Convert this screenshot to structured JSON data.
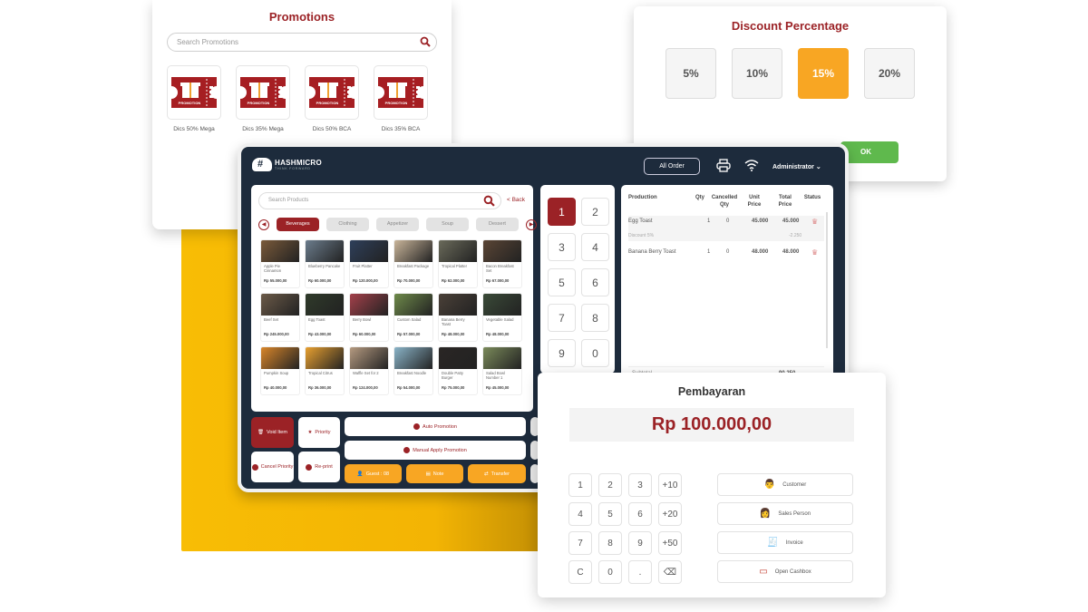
{
  "promotions": {
    "title": "Promotions",
    "search_placeholder": "Search Promotions",
    "ticket_text": "PROMOTION",
    "items": [
      {
        "label": "Dics 50% Mega"
      },
      {
        "label": "Dics 35% Mega"
      },
      {
        "label": "Dics 50% BCA"
      },
      {
        "label": "Dics 35% BCA"
      }
    ]
  },
  "discount": {
    "title": "Discount Percentage",
    "options": [
      "5%",
      "10%",
      "15%",
      "20%"
    ],
    "selected": "15%",
    "ok_label": "OK"
  },
  "header": {
    "brand": "HASHMICRO",
    "tagline": "THINK FORWARD",
    "all_order_label": "All Order",
    "user": "Administrator"
  },
  "products": {
    "search_placeholder": "Search Products",
    "back_label": "< Back",
    "categories": [
      "Beverages",
      "Clothing",
      "Appetizer",
      "Soup",
      "Dessert"
    ],
    "selected_category": "Beverages",
    "items": [
      {
        "name": "Apple Pie Cinnamon",
        "price": "Rp 55.000,00",
        "color": "#7a5a3a"
      },
      {
        "name": "Blueberry Pancake",
        "price": "Rp 60.000,00",
        "color": "#6b7c8c"
      },
      {
        "name": "Fruit Platter",
        "price": "Rp 120.000,00",
        "color": "#2e3f5a"
      },
      {
        "name": "Breakfast Package",
        "price": "Rp 70.000,00",
        "color": "#c9b59a"
      },
      {
        "name": "Tropical Platter",
        "price": "Rp 62.000,00",
        "color": "#6a6a5a"
      },
      {
        "name": "Bacon Breakfast Set",
        "price": "Rp 67.000,00",
        "color": "#5a4535"
      },
      {
        "name": "Beef Set",
        "price": "Rp 245.000,00",
        "color": "#6b5a48"
      },
      {
        "name": "Egg Toast",
        "price": "Rp 43.000,00",
        "color": "#2f3a2a"
      },
      {
        "name": "Berry Bowl",
        "price": "Rp 60.000,00",
        "color": "#a3404a"
      },
      {
        "name": "Custom Salad",
        "price": "Rp 57.000,00",
        "color": "#6e8a4a"
      },
      {
        "name": "Banana Berry Toast",
        "price": "Rp 48.000,00",
        "color": "#4a4038"
      },
      {
        "name": "Vegetable Salad",
        "price": "Rp 48.000,00",
        "color": "#3a4a38"
      },
      {
        "name": "Pumpkin Soup",
        "price": "Rp 40.000,00",
        "color": "#d9862a"
      },
      {
        "name": "Tropical Citrus",
        "price": "Rp 36.000,00",
        "color": "#e8a030"
      },
      {
        "name": "Waffle Set for 2",
        "price": "Rp 124.000,00",
        "color": "#b59a80"
      },
      {
        "name": "Breakfast Noodle",
        "price": "Rp 54.000,00",
        "color": "#8ab4c8"
      },
      {
        "name": "Double Patty Burger",
        "price": "Rp 75.000,00",
        "color": "#2a2624"
      },
      {
        "name": "Salad Bowl Number 1",
        "price": "Rp 45.000,00",
        "color": "#7a8a5a"
      }
    ]
  },
  "numpad": [
    "1",
    "2",
    "3",
    "4",
    "5",
    "6",
    "7",
    "8",
    "9",
    "0"
  ],
  "numpad_selected": "1",
  "order": {
    "headers": [
      "Production",
      "Qty",
      "Cancelled Qty",
      "Unit Price",
      "Total Price",
      "Status"
    ],
    "rows": [
      {
        "name": "Egg Toast",
        "qty": "1",
        "cancelled": "0",
        "unit": "45.000",
        "total": "45.000",
        "discount_label": "Discount 5%",
        "discount_value": "-2.250"
      },
      {
        "name": "Banana Berry Toast",
        "qty": "1",
        "cancelled": "0",
        "unit": "48.000",
        "total": "48.000"
      }
    ],
    "subtotal_label": "Subtotal",
    "subtotal_value": "90.250"
  },
  "actions": {
    "void_item": "Void Item",
    "priority": "Priority",
    "cancel_priority": "Cancel Priority",
    "reprint": "Re-print",
    "auto_promotion": "Auto Promotion",
    "manual_promotion": "Manual Apply Promotion",
    "guest": "Guest : 08",
    "note": "Note",
    "transfer": "Transfer"
  },
  "payment": {
    "title": "Pembayaran",
    "amount": "Rp 100.000,00",
    "keys": [
      "1",
      "2",
      "3",
      "+10",
      "4",
      "5",
      "6",
      "+20",
      "7",
      "8",
      "9",
      "+50",
      "C",
      "0",
      ".",
      "⌫"
    ],
    "side_buttons": [
      "Customer",
      "Sales Person",
      "Invoice",
      "Open Cashbox"
    ]
  },
  "colors": {
    "brand_red": "#9b2226",
    "accent_orange": "#f8a623",
    "ok_green": "#5fb94d",
    "navy": "#1d2b3c",
    "yellow": "#f8bd05"
  }
}
